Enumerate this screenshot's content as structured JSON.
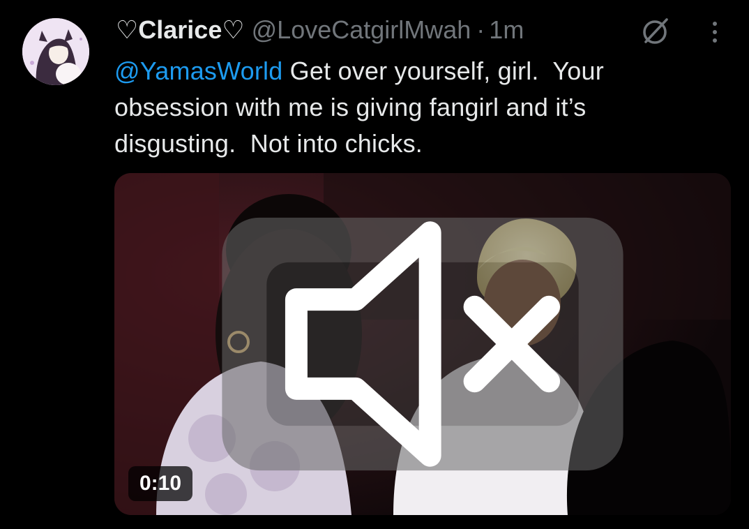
{
  "tweet": {
    "display_name": "♡Clarice♡",
    "handle": "@LoveCatgirlMwah",
    "separator": "·",
    "time": "1m",
    "mention": "@YamasWorld",
    "text": " Get over yourself, girl.  Your\nobsession with me is giving fangirl and it’s\ndisgusting.  Not into chicks."
  },
  "media": {
    "duration": "0:10",
    "muted": true
  },
  "icons": {
    "grok": "grok-icon",
    "more": "more-icon",
    "mute": "volume-muted-icon"
  },
  "colors": {
    "background": "#000000",
    "text": "#e7e9ea",
    "secondary": "#71767b",
    "link": "#1d9bf0"
  }
}
